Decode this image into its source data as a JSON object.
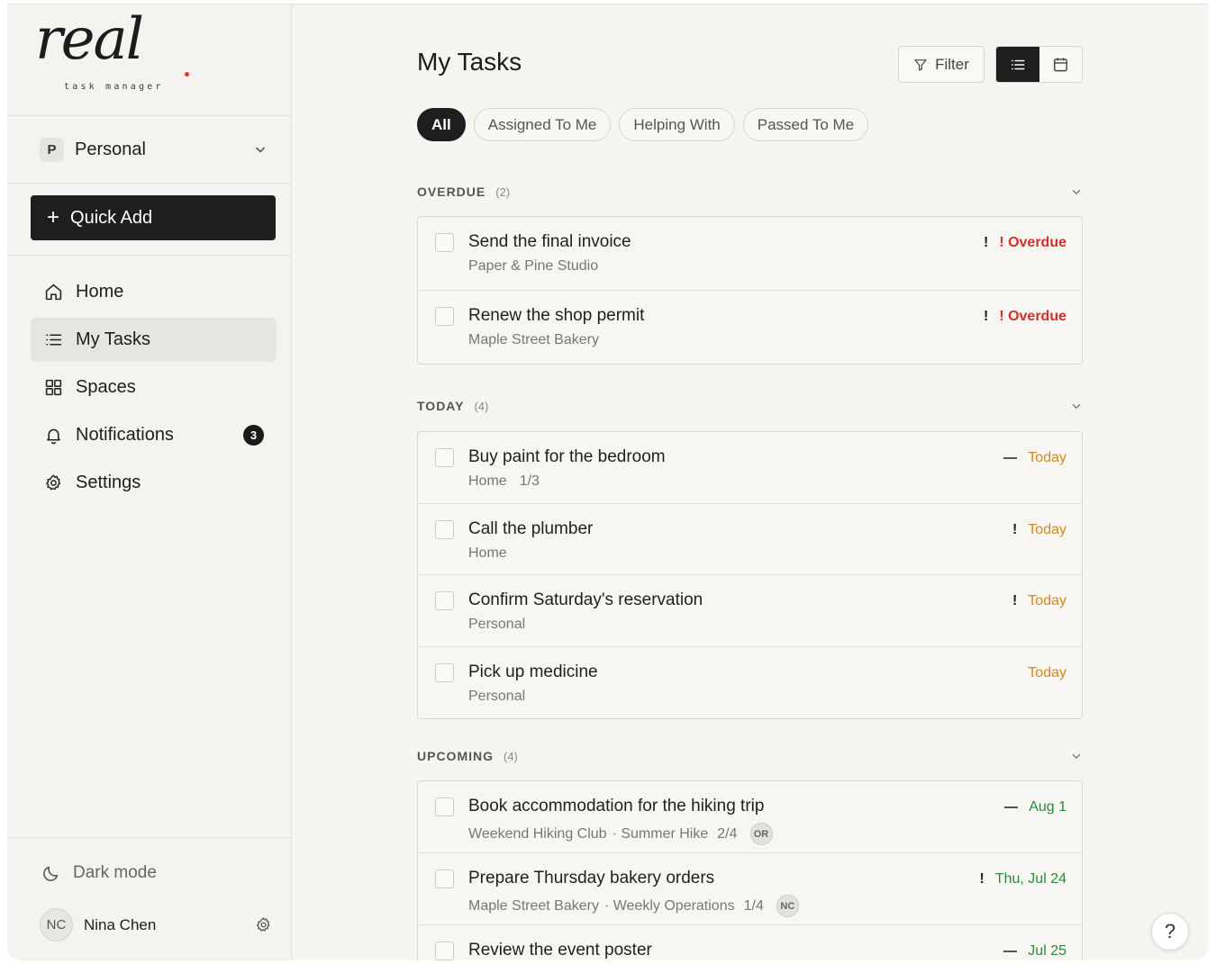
{
  "logo": {
    "word": "real",
    "tagline": "task manager"
  },
  "workspace": {
    "badge": "P",
    "name": "Personal"
  },
  "quick_add": {
    "label": "Quick Add"
  },
  "nav": [
    {
      "label": "Home",
      "icon": "home-icon"
    },
    {
      "label": "My Tasks",
      "icon": "list-icon",
      "active": true
    },
    {
      "label": "Spaces",
      "icon": "grid-icon"
    },
    {
      "label": "Notifications",
      "icon": "bell-icon",
      "badge": "3"
    },
    {
      "label": "Settings",
      "icon": "gear-icon"
    }
  ],
  "sidebar_bottom": {
    "dark_mode_label": "Dark mode",
    "user": {
      "initials": "NC",
      "name": "Nina Chen"
    }
  },
  "header": {
    "title": "My Tasks",
    "filter_label": "Filter",
    "view_mode": "list"
  },
  "tabs": [
    {
      "label": "All",
      "active": true
    },
    {
      "label": "Assigned To Me"
    },
    {
      "label": "Helping With"
    },
    {
      "label": "Passed To Me"
    }
  ],
  "sections": {
    "overdue": {
      "label": "OVERDUE",
      "count": "(2)",
      "tasks": [
        {
          "title": "Send the final invoice",
          "meta": "Paper & Pine Studio",
          "priority": "!",
          "due": "! Overdue"
        },
        {
          "title": "Renew the shop permit",
          "meta": "Maple Street Bakery",
          "priority": "!",
          "due": "! Overdue"
        }
      ]
    },
    "today": {
      "label": "TODAY",
      "count": "(4)",
      "tasks": [
        {
          "title": "Buy paint for the bedroom",
          "meta": "Home",
          "progress": "1/3",
          "priority": "—",
          "due": "Today"
        },
        {
          "title": "Call the plumber",
          "meta": "Home",
          "priority": "!",
          "due": "Today"
        },
        {
          "title": "Confirm Saturday's reservation",
          "meta": "Personal",
          "priority": "!",
          "due": "Today"
        },
        {
          "title": "Pick up medicine",
          "meta": "Personal",
          "due": "Today"
        }
      ]
    },
    "upcoming": {
      "label": "UPCOMING",
      "count": "(4)",
      "tasks": [
        {
          "title": "Book accommodation for the hiking trip",
          "meta": "Weekend Hiking Club",
          "sub": "· Summer Hike",
          "progress": "2/4",
          "avatar": "OR",
          "priority": "—",
          "due": "Aug 1"
        },
        {
          "title": "Prepare Thursday bakery orders",
          "meta": "Maple Street Bakery",
          "sub": "· Weekly Operations",
          "progress": "1/4",
          "avatar": "NC",
          "priority": "!",
          "due": "Thu, Jul 24"
        },
        {
          "title": "Review the event poster",
          "priority": "—",
          "due": "Jul 25"
        }
      ]
    }
  },
  "help": {
    "label": "?"
  },
  "colors": {
    "overdue": "#d42f28",
    "today": "#d3881f",
    "upcoming": "#2c8a3c",
    "dark": "#1e1e1e"
  }
}
